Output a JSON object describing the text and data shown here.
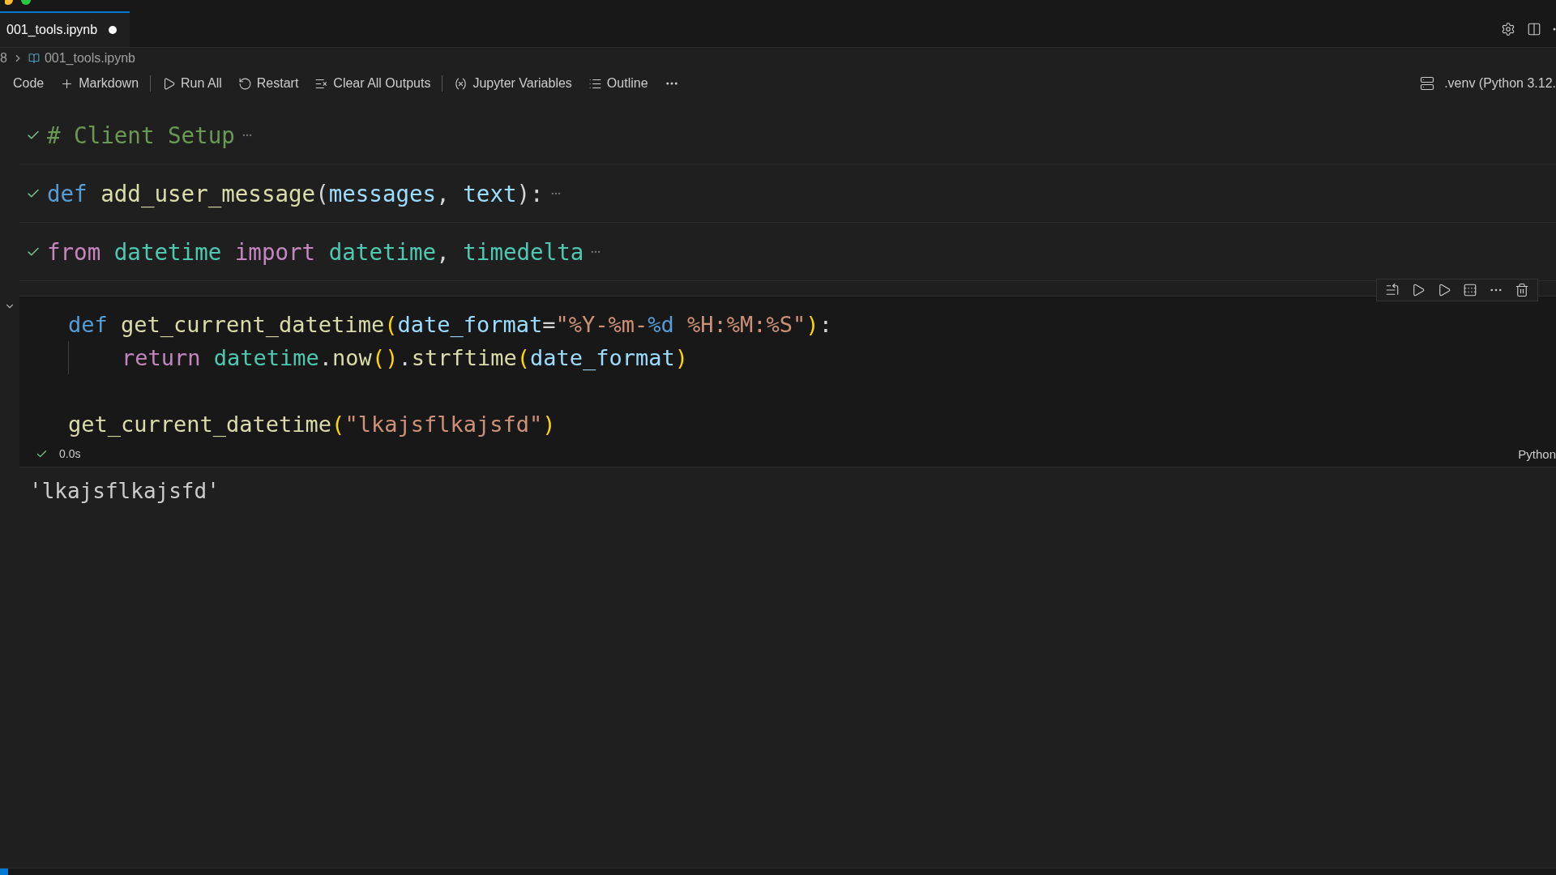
{
  "tab": {
    "label": "001_tools.ipynb",
    "dirty": true
  },
  "breadcrumb": [
    "8",
    "001_tools.ipynb"
  ],
  "toolbar": [
    {
      "kind": "none",
      "label": "Code"
    },
    {
      "kind": "plus",
      "label": "Markdown"
    },
    {
      "kind": "divider"
    },
    {
      "kind": "run",
      "label": "Run All"
    },
    {
      "kind": "restart",
      "label": "Restart"
    },
    {
      "kind": "clear",
      "label": "Clear All Outputs"
    },
    {
      "kind": "divider"
    },
    {
      "kind": "variables",
      "label": "Jupyter Variables"
    },
    {
      "kind": "outline",
      "label": "Outline"
    },
    {
      "kind": "more"
    }
  ],
  "kernel": ".venv (Python 3.12.",
  "collapsed_cells": [
    {
      "succeeded": true,
      "tokens": [
        {
          "kind": "comment",
          "text": "# Client Setup"
        }
      ]
    },
    {
      "succeeded": true,
      "tokens": [
        {
          "kind": "keyword",
          "text": "def "
        },
        {
          "kind": "function",
          "text": "add_user_message"
        },
        {
          "kind": "plain",
          "text": "("
        },
        {
          "kind": "variable",
          "text": "messages"
        },
        {
          "kind": "plain",
          "text": ", "
        },
        {
          "kind": "variable",
          "text": "text"
        },
        {
          "kind": "plain",
          "text": "):"
        }
      ]
    },
    {
      "succeeded": true,
      "tokens": [
        {
          "kind": "control",
          "text": "from "
        },
        {
          "kind": "class",
          "text": "datetime "
        },
        {
          "kind": "control",
          "text": "import "
        },
        {
          "kind": "class",
          "text": "datetime"
        },
        {
          "kind": "plain",
          "text": ", "
        },
        {
          "kind": "class",
          "text": "timedelta"
        }
      ]
    }
  ],
  "active_cell": {
    "expanded": true,
    "lines": [
      {
        "kind": "code",
        "tokens": [
          {
            "kind": "keyword",
            "text": "def "
          },
          {
            "kind": "function",
            "text": "get_current_datetime"
          },
          {
            "kind": "paren",
            "text": "("
          },
          {
            "kind": "variable",
            "text": "date_format"
          },
          {
            "kind": "plain",
            "text": "="
          },
          {
            "kind": "string",
            "text": "\"%Y-%m-"
          },
          {
            "kind": "keyword",
            "text": "%d"
          },
          {
            "kind": "string",
            "text": " %H:%M:%S\""
          },
          {
            "kind": "paren",
            "text": ")"
          },
          {
            "kind": "plain",
            "text": ":"
          }
        ]
      },
      {
        "kind": "indented",
        "tokens": [
          {
            "kind": "control",
            "text": "return "
          },
          {
            "kind": "class",
            "text": "datetime"
          },
          {
            "kind": "plain",
            "text": "."
          },
          {
            "kind": "function",
            "text": "now"
          },
          {
            "kind": "paren",
            "text": "()"
          },
          {
            "kind": "plain",
            "text": "."
          },
          {
            "kind": "function",
            "text": "strftime"
          },
          {
            "kind": "paren",
            "text": "("
          },
          {
            "kind": "variable",
            "text": "date_format"
          },
          {
            "kind": "paren",
            "text": ")"
          }
        ]
      },
      {
        "kind": "blank"
      },
      {
        "kind": "code",
        "tokens": [
          {
            "kind": "function",
            "text": "get_current_datetime"
          },
          {
            "kind": "paren",
            "text": "("
          },
          {
            "kind": "string",
            "text": "\"lkajsflkajsfd\""
          },
          {
            "kind": "paren",
            "text": ")"
          }
        ]
      }
    ],
    "succeeded": true,
    "duration": "0.0s",
    "language": "Python",
    "output": "'lkajsflkajsfd'"
  }
}
